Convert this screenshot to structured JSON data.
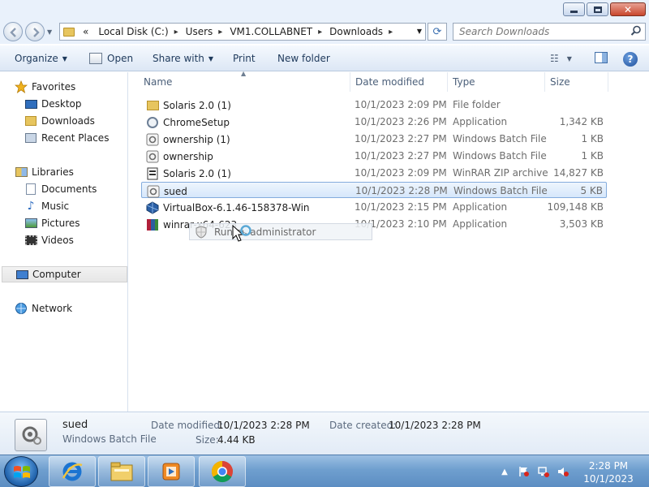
{
  "address": {
    "chevrons": "«",
    "crumbs": [
      "Local Disk (C:)",
      "Users",
      "VM1.COLLABNET",
      "Downloads"
    ]
  },
  "search": {
    "placeholder": "Search Downloads"
  },
  "toolbar": {
    "organize": "Organize",
    "open": "Open",
    "share_with": "Share with",
    "print": "Print",
    "new_folder": "New folder"
  },
  "nav": {
    "favorites": "Favorites",
    "desktop": "Desktop",
    "downloads": "Downloads",
    "recent_places": "Recent Places",
    "libraries": "Libraries",
    "documents": "Documents",
    "music": "Music",
    "pictures": "Pictures",
    "videos": "Videos",
    "computer": "Computer",
    "network": "Network"
  },
  "columns": {
    "name": "Name",
    "date_modified": "Date modified",
    "type": "Type",
    "size": "Size"
  },
  "files": [
    {
      "name": "Solaris 2.0 (1)",
      "date": "10/1/2023 2:09 PM",
      "type": "File folder",
      "size": "",
      "icon": "folder-icon"
    },
    {
      "name": "ChromeSetup",
      "date": "10/1/2023 2:26 PM",
      "type": "Application",
      "size": "1,342 KB",
      "icon": "chrome-setup-icon"
    },
    {
      "name": "ownership (1)",
      "date": "10/1/2023 2:27 PM",
      "type": "Windows Batch File",
      "size": "1 KB",
      "icon": "batch-file-icon"
    },
    {
      "name": "ownership",
      "date": "10/1/2023 2:27 PM",
      "type": "Windows Batch File",
      "size": "1 KB",
      "icon": "batch-file-icon"
    },
    {
      "name": "Solaris 2.0 (1)",
      "date": "10/1/2023 2:09 PM",
      "type": "WinRAR ZIP archive",
      "size": "14,827 KB",
      "icon": "zip-archive-icon"
    },
    {
      "name": "sued",
      "date": "10/1/2023 2:28 PM",
      "type": "Windows Batch File",
      "size": "5 KB",
      "icon": "batch-file-icon"
    },
    {
      "name": "VirtualBox-6.1.46-158378-Win",
      "date": "10/1/2023 2:15 PM",
      "type": "Application",
      "size": "109,148 KB",
      "icon": "virtualbox-icon"
    },
    {
      "name": "winrar-x64-623",
      "date": "10/1/2023 2:10 PM",
      "type": "Application",
      "size": "3,503 KB",
      "icon": "winrar-icon"
    }
  ],
  "selected_file": "sued",
  "drag_ghost": {
    "label": "Run as administrator"
  },
  "details": {
    "name": "sued",
    "type": "Windows Batch File",
    "date_modified_label": "Date modified:",
    "date_modified": "10/1/2023 2:28 PM",
    "size_label": "Size:",
    "size": "4.44 KB",
    "date_created_label": "Date created:",
    "date_created": "10/1/2023 2:28 PM"
  },
  "taskbar": {
    "apps": [
      "internet-explorer-icon",
      "file-explorer-icon",
      "media-player-icon",
      "chrome-icon"
    ],
    "time": "2:28 PM",
    "date": "10/1/2023"
  },
  "colors": {
    "selection": "#d6e7fb",
    "taskbar": "#6f9fcf",
    "accent": "#1e395b"
  }
}
